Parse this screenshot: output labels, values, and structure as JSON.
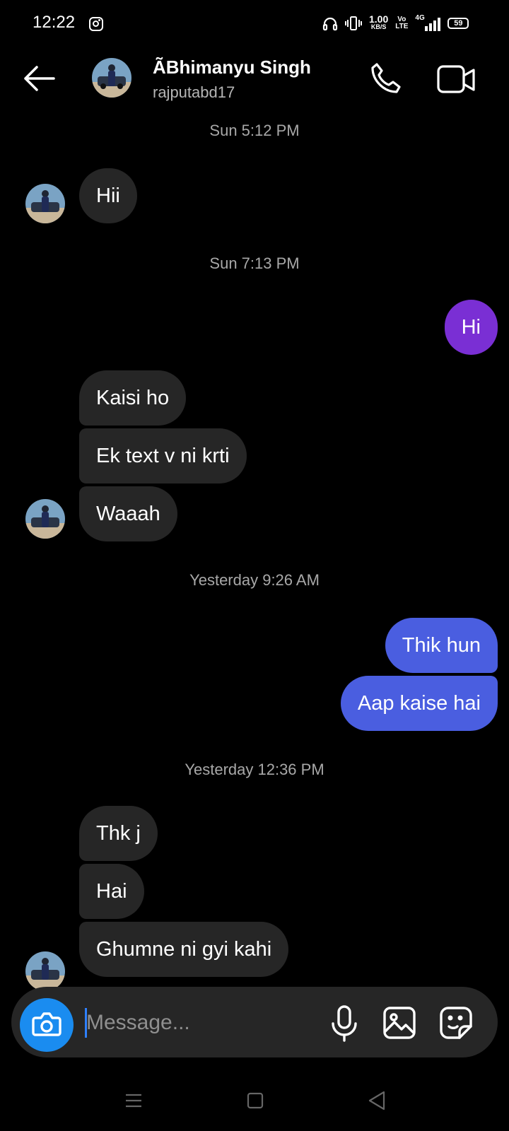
{
  "status_bar": {
    "time": "12:22",
    "speed_value": "1.00",
    "speed_unit": "KB/S",
    "volte_top": "Vo",
    "volte_bottom": "LTE",
    "network": "4G",
    "battery": "59"
  },
  "header": {
    "contact_name": "ÃBhimanyu Singh",
    "username": "rajputabd17"
  },
  "conversation": {
    "timestamps": [
      "Sun 5:12 PM",
      "Sun 7:13 PM",
      "Yesterday 9:26 AM",
      "Yesterday 12:36 PM"
    ],
    "messages": [
      {
        "from": "them",
        "text": "Hii"
      },
      {
        "from": "me",
        "text": "Hi"
      },
      {
        "from": "them",
        "text": "Kaisi ho"
      },
      {
        "from": "them",
        "text": "Ek text v ni krti"
      },
      {
        "from": "them",
        "text": "Waaah"
      },
      {
        "from": "me",
        "text": "Thik hun"
      },
      {
        "from": "me",
        "text": "Aap kaise hai"
      },
      {
        "from": "them",
        "text": "Thk j"
      },
      {
        "from": "them",
        "text": "Hai"
      },
      {
        "from": "them",
        "text": "Ghumne ni gyi kahi"
      }
    ]
  },
  "composer": {
    "placeholder": "Message..."
  },
  "colors": {
    "background": "#000000",
    "incoming_bubble": "#262626",
    "outgoing_purple": "#7a2fd4",
    "outgoing_blue": "#4a5ee0",
    "camera_button": "#1a8cf0"
  },
  "icons": [
    "instagram-icon",
    "headphones-icon",
    "vibrate-icon",
    "signal-icon",
    "battery-icon",
    "back-arrow-icon",
    "phone-icon",
    "video-camera-icon",
    "camera-icon",
    "microphone-icon",
    "gallery-icon",
    "sticker-icon",
    "nav-menu-icon",
    "nav-home-icon",
    "nav-back-icon"
  ]
}
